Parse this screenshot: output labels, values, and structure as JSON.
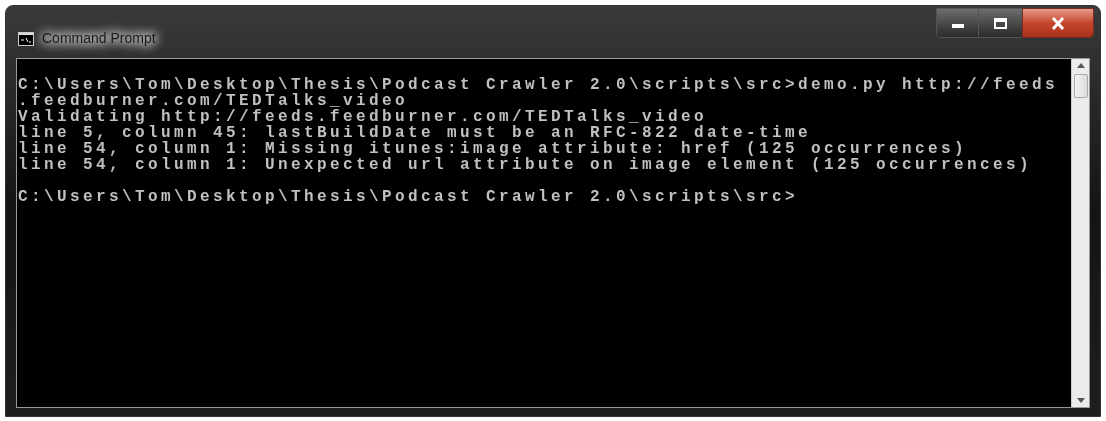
{
  "window": {
    "title": "Command Prompt"
  },
  "console": {
    "blocks": [
      {
        "lines": [
          "C:\\Users\\Tom\\Desktop\\Thesis\\Podcast Crawler 2.0\\scripts\\src>demo.py http://feeds",
          ".feedburner.com/TEDTalks_video",
          "Validating http://feeds.feedburner.com/TEDTalks_video",
          "line 5, column 45: lastBuildDate must be an RFC-822 date-time",
          "line 54, column 1: Missing itunes:image attribute: href (125 occurrences)",
          "line 54, column 1: Unexpected url attribute on image element (125 occurrences)"
        ]
      },
      {
        "lines": [
          "C:\\Users\\Tom\\Desktop\\Thesis\\Podcast Crawler 2.0\\scripts\\src>"
        ]
      }
    ]
  }
}
